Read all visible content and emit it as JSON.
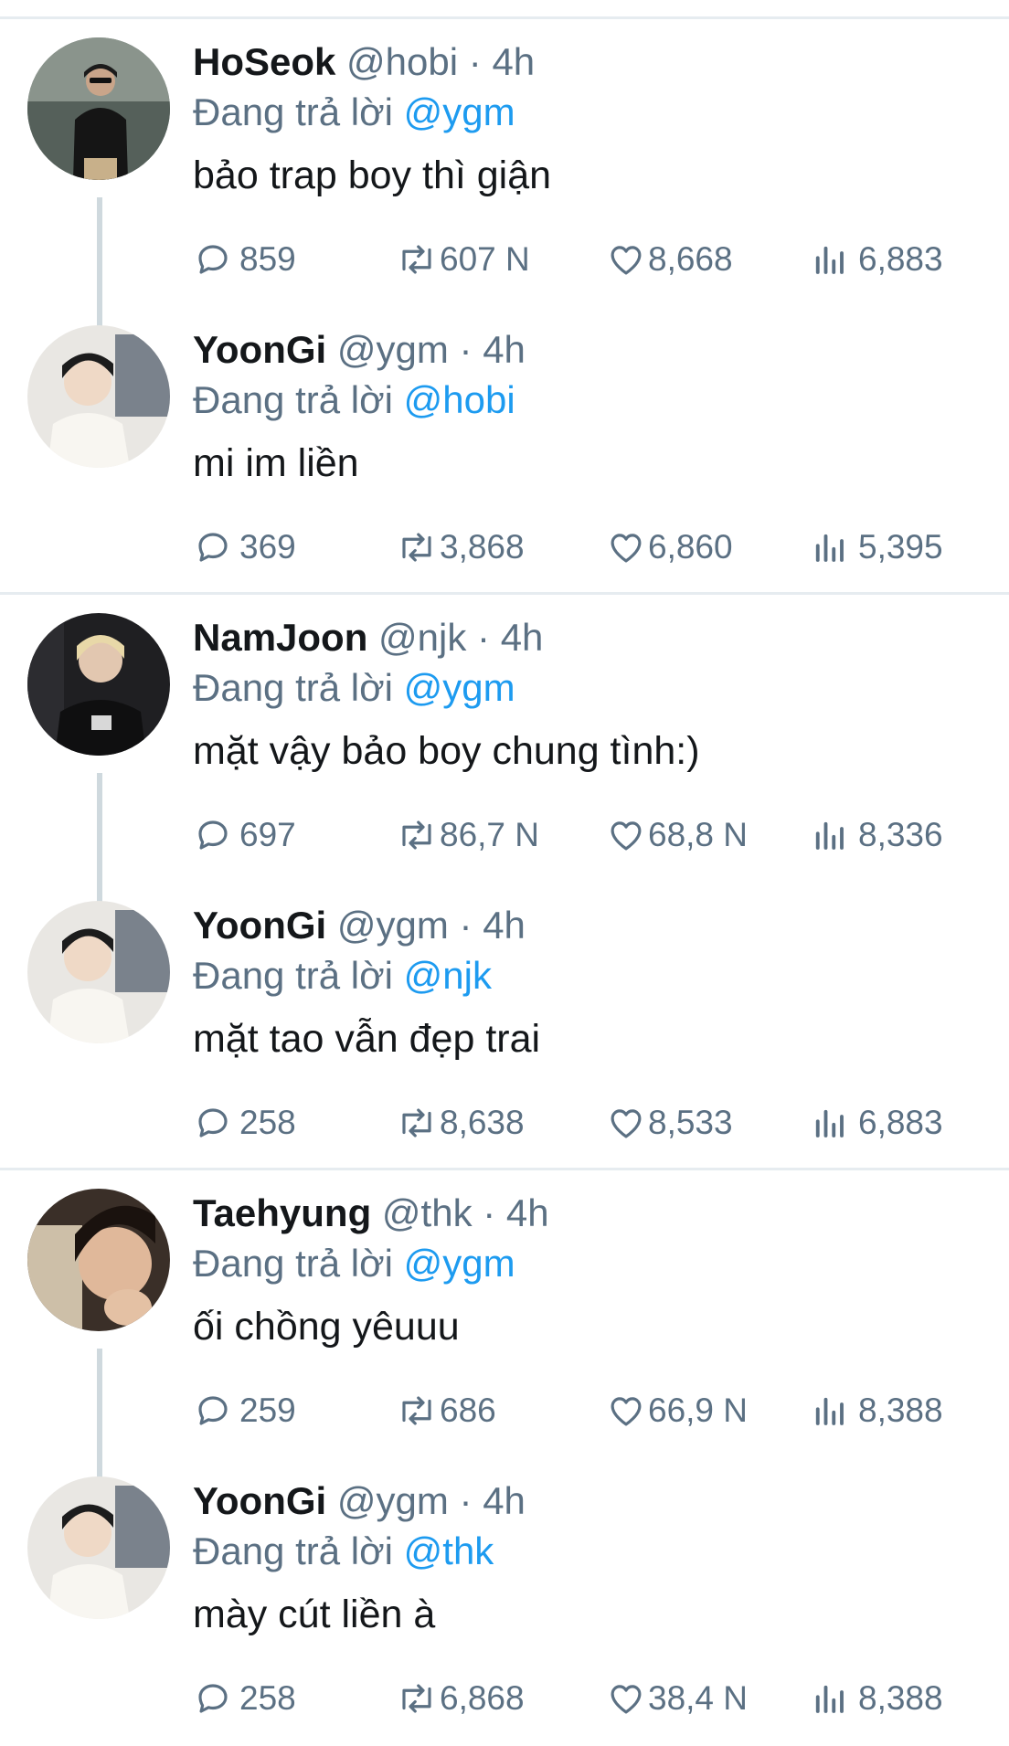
{
  "reply_prefix": "Đang trả lời",
  "threads": [
    {
      "tweets": [
        {
          "name": "HoSeok",
          "handle": "@hobi",
          "separator": "·",
          "time": "4h",
          "reply_to": "@ygm",
          "text": "bảo trap boy thì giận",
          "replies": "859",
          "retweets": "607 N",
          "likes": "8,668",
          "views": "6,883"
        },
        {
          "name": "YoonGi",
          "handle": "@ygm",
          "separator": "·",
          "time": "4h",
          "reply_to": "@hobi",
          "text": "mi im liền",
          "replies": "369",
          "retweets": "3,868",
          "likes": "6,860",
          "views": "5,395"
        }
      ]
    },
    {
      "tweets": [
        {
          "name": "NamJoon",
          "handle": "@njk",
          "separator": "·",
          "time": "4h",
          "reply_to": "@ygm",
          "text": "mặt vậy bảo boy chung tình:)",
          "replies": "697",
          "retweets": "86,7 N",
          "likes": "68,8 N",
          "views": "8,336"
        },
        {
          "name": "YoonGi",
          "handle": "@ygm",
          "separator": "·",
          "time": "4h",
          "reply_to": "@njk",
          "text": "mặt tao vẫn đẹp trai",
          "replies": "258",
          "retweets": "8,638",
          "likes": "8,533",
          "views": "6,883"
        }
      ]
    },
    {
      "tweets": [
        {
          "name": "Taehyung",
          "handle": "@thk",
          "separator": "·",
          "time": "4h",
          "reply_to": "@ygm",
          "text": "ối chồng yêuuu",
          "replies": "259",
          "retweets": "686",
          "likes": "66,9 N",
          "views": "8,388"
        },
        {
          "name": "YoonGi",
          "handle": "@ygm",
          "separator": "·",
          "time": "4h",
          "reply_to": "@thk",
          "text": "mày cút liền à",
          "replies": "258",
          "retweets": "6,868",
          "likes": "38,4 N",
          "views": "8,388"
        }
      ]
    }
  ],
  "icons": {
    "reply": "reply-icon",
    "retweet": "retweet-icon",
    "like": "heart-icon",
    "views": "views-icon"
  },
  "colors": {
    "text": "#14171a",
    "secondary": "#5b7083",
    "mention": "#1d9bf0",
    "divider": "#e6ecf0",
    "thread_line": "#cfd9de"
  }
}
